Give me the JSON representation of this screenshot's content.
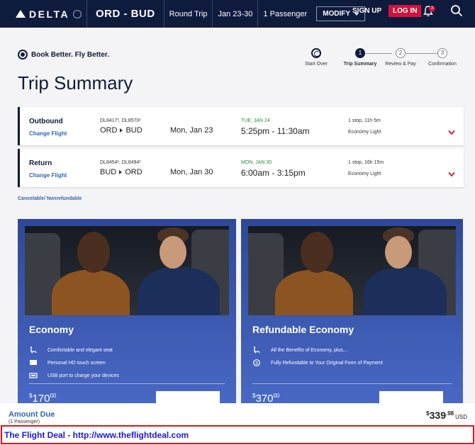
{
  "nav": {
    "logo": "DELTA",
    "route": "ORD - BUD",
    "trip_type": "Round Trip",
    "dates": "Jan 23-30",
    "passengers": "1 Passenger",
    "modify": "MODIFY",
    "signup": "SIGN UP",
    "login": "LOG IN",
    "notification_count": "3"
  },
  "brand_tagline": "Book Better. Fly Better.",
  "page_title": "Trip Summary",
  "stepper": [
    {
      "num": "",
      "label": "Start Over",
      "state": "start"
    },
    {
      "num": "1",
      "label": "Trip Summary",
      "state": "active"
    },
    {
      "num": "2",
      "label": "Review & Pay",
      "state": "todo"
    },
    {
      "num": "3",
      "label": "Confirmation",
      "state": "todo"
    }
  ],
  "flights": [
    {
      "direction": "Outbound",
      "change": "Change Flight",
      "flight_numbers": "DL8417¹, DL8570¹",
      "origin": "ORD",
      "destination": "BUD",
      "date": "Mon, Jan 23",
      "arrival_day": "TUE, JAN 24",
      "times": "5:25pm - 11:30am",
      "stops": "1 stop, 11h 5m",
      "cabin": "Economy Light"
    },
    {
      "direction": "Return",
      "change": "Change Flight",
      "flight_numbers": "DL8454¹, DL8494¹",
      "origin": "BUD",
      "destination": "ORD",
      "date": "Mon, Jan 30",
      "arrival_day": "MON, JAN 30",
      "times": "6:00am - 3:15pm",
      "stops": "1 stop, 16h 15m",
      "cabin": "Economy Light"
    }
  ],
  "cancel_note": "Cancelable/ Nonrefundable",
  "fares": [
    {
      "name": "Economy",
      "features": [
        {
          "icon": "seat-icon",
          "text": "Comfortable and elegant seat"
        },
        {
          "icon": "screen-icon",
          "text": "Personal HD touch screen"
        },
        {
          "icon": "usb-icon",
          "text": "USB port to charge your devices"
        }
      ],
      "price_whole": "170",
      "price_cents": "00"
    },
    {
      "name": "Refundable Economy",
      "features": [
        {
          "icon": "seat-icon",
          "text": "All the Benefits of Economy, plus..."
        },
        {
          "icon": "refund-icon",
          "text": "Fully Refundable to Your Original Form of Payment"
        }
      ],
      "price_whole": "370",
      "price_cents": "00"
    }
  ],
  "amount_due": {
    "label": "Amount Due",
    "passengers": "(1 Passenger)",
    "whole": "339",
    "cents": ".98",
    "currency": "USD"
  },
  "watermark": "The Flight Deal - http://www.theflightdeal.com",
  "colors": {
    "navy": "#0f1b3d",
    "red": "#d3123b",
    "link_blue": "#3466b0",
    "fare_blue": "#3a58b0",
    "arrival_green": "#2d8a3e"
  }
}
